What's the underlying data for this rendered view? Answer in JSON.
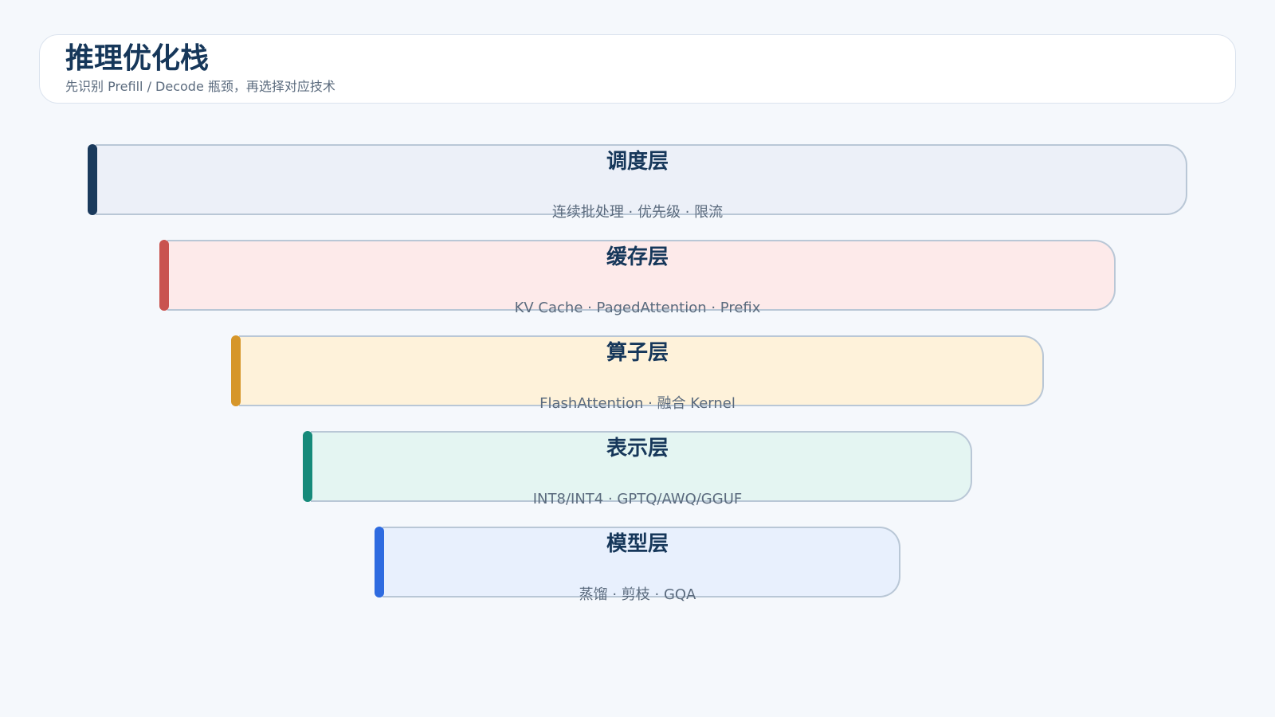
{
  "header": {
    "title": "推理优化栈",
    "subtitle": "先识别 Prefill / Decode 瓶颈，再选择对应技术"
  },
  "layers": [
    {
      "name": "调度层",
      "desc": "连续批处理 · 优先级 · 限流",
      "accent_color": "#1a3a5c",
      "fill_color": "#ecf0f8"
    },
    {
      "name": "缓存层",
      "desc": "KV Cache · PagedAttention · Prefix",
      "accent_color": "#c9534f",
      "fill_color": "#fdeaea"
    },
    {
      "name": "算子层",
      "desc": "FlashAttention · 融合 Kernel",
      "accent_color": "#d6962a",
      "fill_color": "#fef2da"
    },
    {
      "name": "表示层",
      "desc": "INT8/INT4 · GPTQ/AWQ/GGUF",
      "accent_color": "#168a7a",
      "fill_color": "#e4f5f2"
    },
    {
      "name": "模型层",
      "desc": "蒸馏 · 剪枝 · GQA",
      "accent_color": "#2e6be0",
      "fill_color": "#e8f0fd"
    }
  ]
}
